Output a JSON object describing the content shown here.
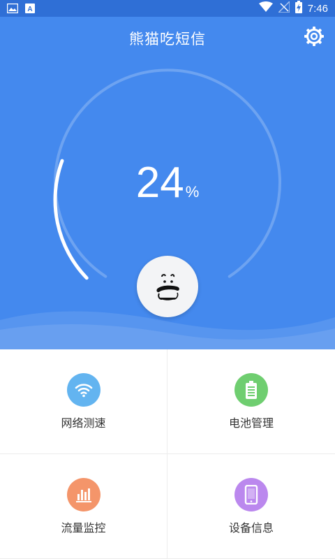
{
  "status_bar": {
    "time": "7:46",
    "left_icons": [
      "image-notification-icon",
      "font-notification-icon"
    ],
    "right_icons": [
      "wifi-icon",
      "no-signal-icon",
      "battery-charging-icon"
    ]
  },
  "header": {
    "title": "熊猫吃短信",
    "settings_icon": "gear-icon"
  },
  "gauge": {
    "value": "24",
    "unit": "%",
    "level_fraction": 0.24
  },
  "grid": {
    "items": [
      {
        "label": "网络测速",
        "icon": "wifi-icon",
        "color": "#63b4f0"
      },
      {
        "label": "电池管理",
        "icon": "battery-icon",
        "color": "#6fce70"
      },
      {
        "label": "流量监控",
        "icon": "bar-chart-icon",
        "color": "#f4956a"
      },
      {
        "label": "设备信息",
        "icon": "phone-icon",
        "color": "#bb88ee"
      }
    ]
  },
  "colors": {
    "status_bar": "#2f6fd6",
    "hero": "#4489ee",
    "accent": "#ffffff"
  }
}
